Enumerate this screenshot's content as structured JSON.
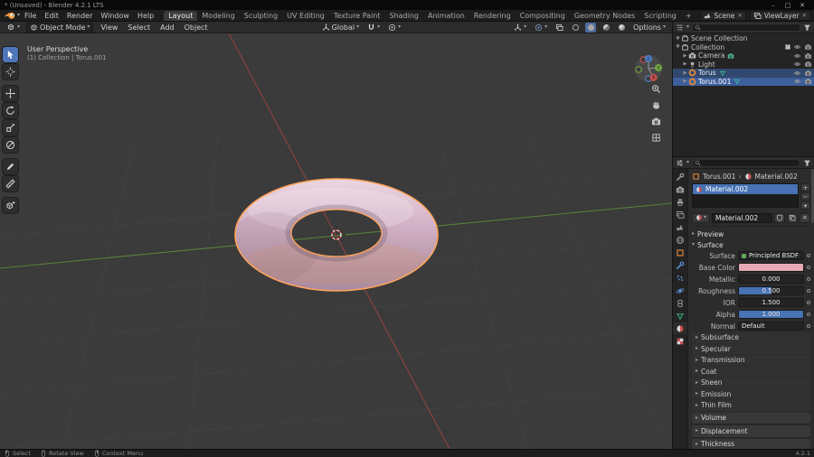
{
  "titlebar": {
    "title": "* (Unsaved) - Blender 4.2.1 LTS",
    "minimize": "–",
    "maximize": "□",
    "close": "✕"
  },
  "menubar": {
    "menus": [
      "File",
      "Edit",
      "Render",
      "Window",
      "Help"
    ],
    "workspaces": [
      "Layout",
      "Modeling",
      "Sculpting",
      "UV Editing",
      "Texture Paint",
      "Shading",
      "Animation",
      "Rendering",
      "Compositing",
      "Geometry Nodes",
      "Scripting"
    ],
    "add_workspace": "+",
    "scene_selector": {
      "label": "Scene",
      "clear": "✕"
    },
    "viewlayer_selector": {
      "label": "ViewLayer",
      "clear": "✕"
    }
  },
  "viewport": {
    "header": {
      "mode": "Object Mode",
      "menus": [
        "View",
        "Select",
        "Add",
        "Object"
      ],
      "orientation": "Global",
      "options_label": "Options"
    },
    "overlay": {
      "view_label": "User Perspective",
      "context_label": "(1) Collection | Torus.001"
    },
    "gizmo": {
      "x": "X",
      "y": "Y",
      "z": "Z"
    }
  },
  "outliner": {
    "rows": [
      {
        "name": "Scene Collection"
      },
      {
        "name": "Collection"
      },
      {
        "name": "Camera"
      },
      {
        "name": "Light"
      },
      {
        "name": "Torus"
      },
      {
        "name": "Torus.001"
      }
    ]
  },
  "properties": {
    "breadcrumb": {
      "object": "Torus.001",
      "separator": "›",
      "material": "Material.002"
    },
    "slot_list": {
      "slots": [
        "Material.002"
      ],
      "add": "+",
      "remove": "−"
    },
    "datablock": {
      "name": "Material.002"
    },
    "sections": {
      "preview": "Preview",
      "surface": "Surface",
      "volume": "Volume",
      "displacement": "Displacement",
      "thickness": "Thickness"
    },
    "surface": {
      "shader_label": "Surface",
      "shader": "Principled BSDF",
      "base_color": {
        "label": "Base Color",
        "hex": "#e8a9b6"
      },
      "metallic": {
        "label": "Metallic",
        "value": "0.000",
        "fill": 0
      },
      "roughness": {
        "label": "Roughness",
        "value": "0.500",
        "fill": 0.5
      },
      "ior": {
        "label": "IOR",
        "value": "1.500",
        "fill": 0
      },
      "alpha": {
        "label": "Alpha",
        "value": "1.000",
        "fill": 1
      },
      "normal": {
        "label": "Normal",
        "value": "Default"
      },
      "subsections": [
        "Subsurface",
        "Specular",
        "Transmission",
        "Coat",
        "Sheen",
        "Emission",
        "Thin Film"
      ]
    },
    "tabs": [
      "tool",
      "render",
      "output",
      "view-layer",
      "scene",
      "world",
      "object",
      "modifiers",
      "particles",
      "physics",
      "constraints",
      "object-data",
      "material",
      "texture"
    ],
    "active_tab": "material"
  },
  "statusbar": {
    "hints": [
      "Select",
      "Rotate View",
      "Context Menu"
    ],
    "version": "4.2.1"
  },
  "colors": {
    "accent": "#4772b3",
    "selection_outline": "#ffa45c",
    "object_orange": "#e0883c",
    "mesh_data_teal": "#3dbf9b",
    "torus_pink": "#cfaec3"
  }
}
